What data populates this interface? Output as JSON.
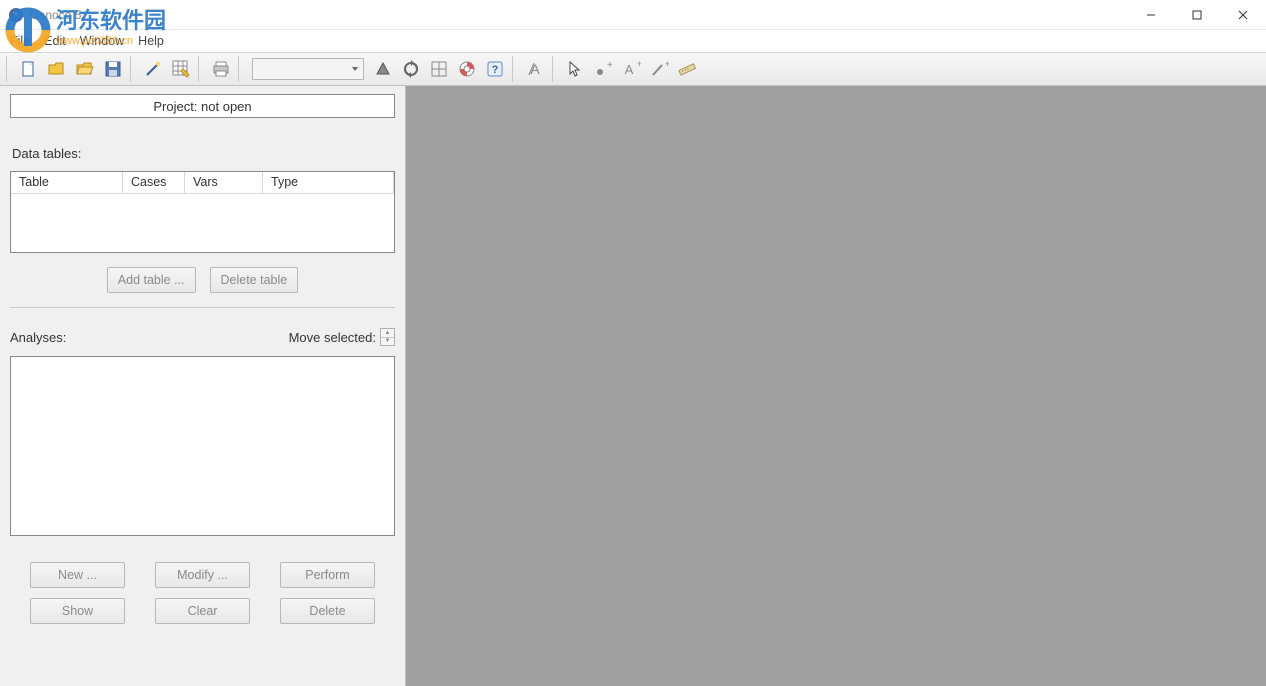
{
  "window": {
    "title": "Canoco 5"
  },
  "menu": {
    "file": "File",
    "edit": "Edit",
    "window": "Window",
    "help": "Help"
  },
  "watermark": {
    "text1": "河东软件园",
    "text2": "www.pc0359.cn"
  },
  "project": {
    "status": "Project: not open"
  },
  "dataTables": {
    "label": "Data tables:",
    "columns": {
      "table": "Table",
      "cases": "Cases",
      "vars": "Vars",
      "type": "Type"
    },
    "addBtn": "Add table ...",
    "deleteBtn": "Delete table"
  },
  "analyses": {
    "label": "Analyses:",
    "moveSelected": "Move selected:",
    "new": "New ...",
    "modify": "Modify ...",
    "perform": "Perform",
    "show": "Show",
    "clear": "Clear",
    "delete": "Delete"
  }
}
